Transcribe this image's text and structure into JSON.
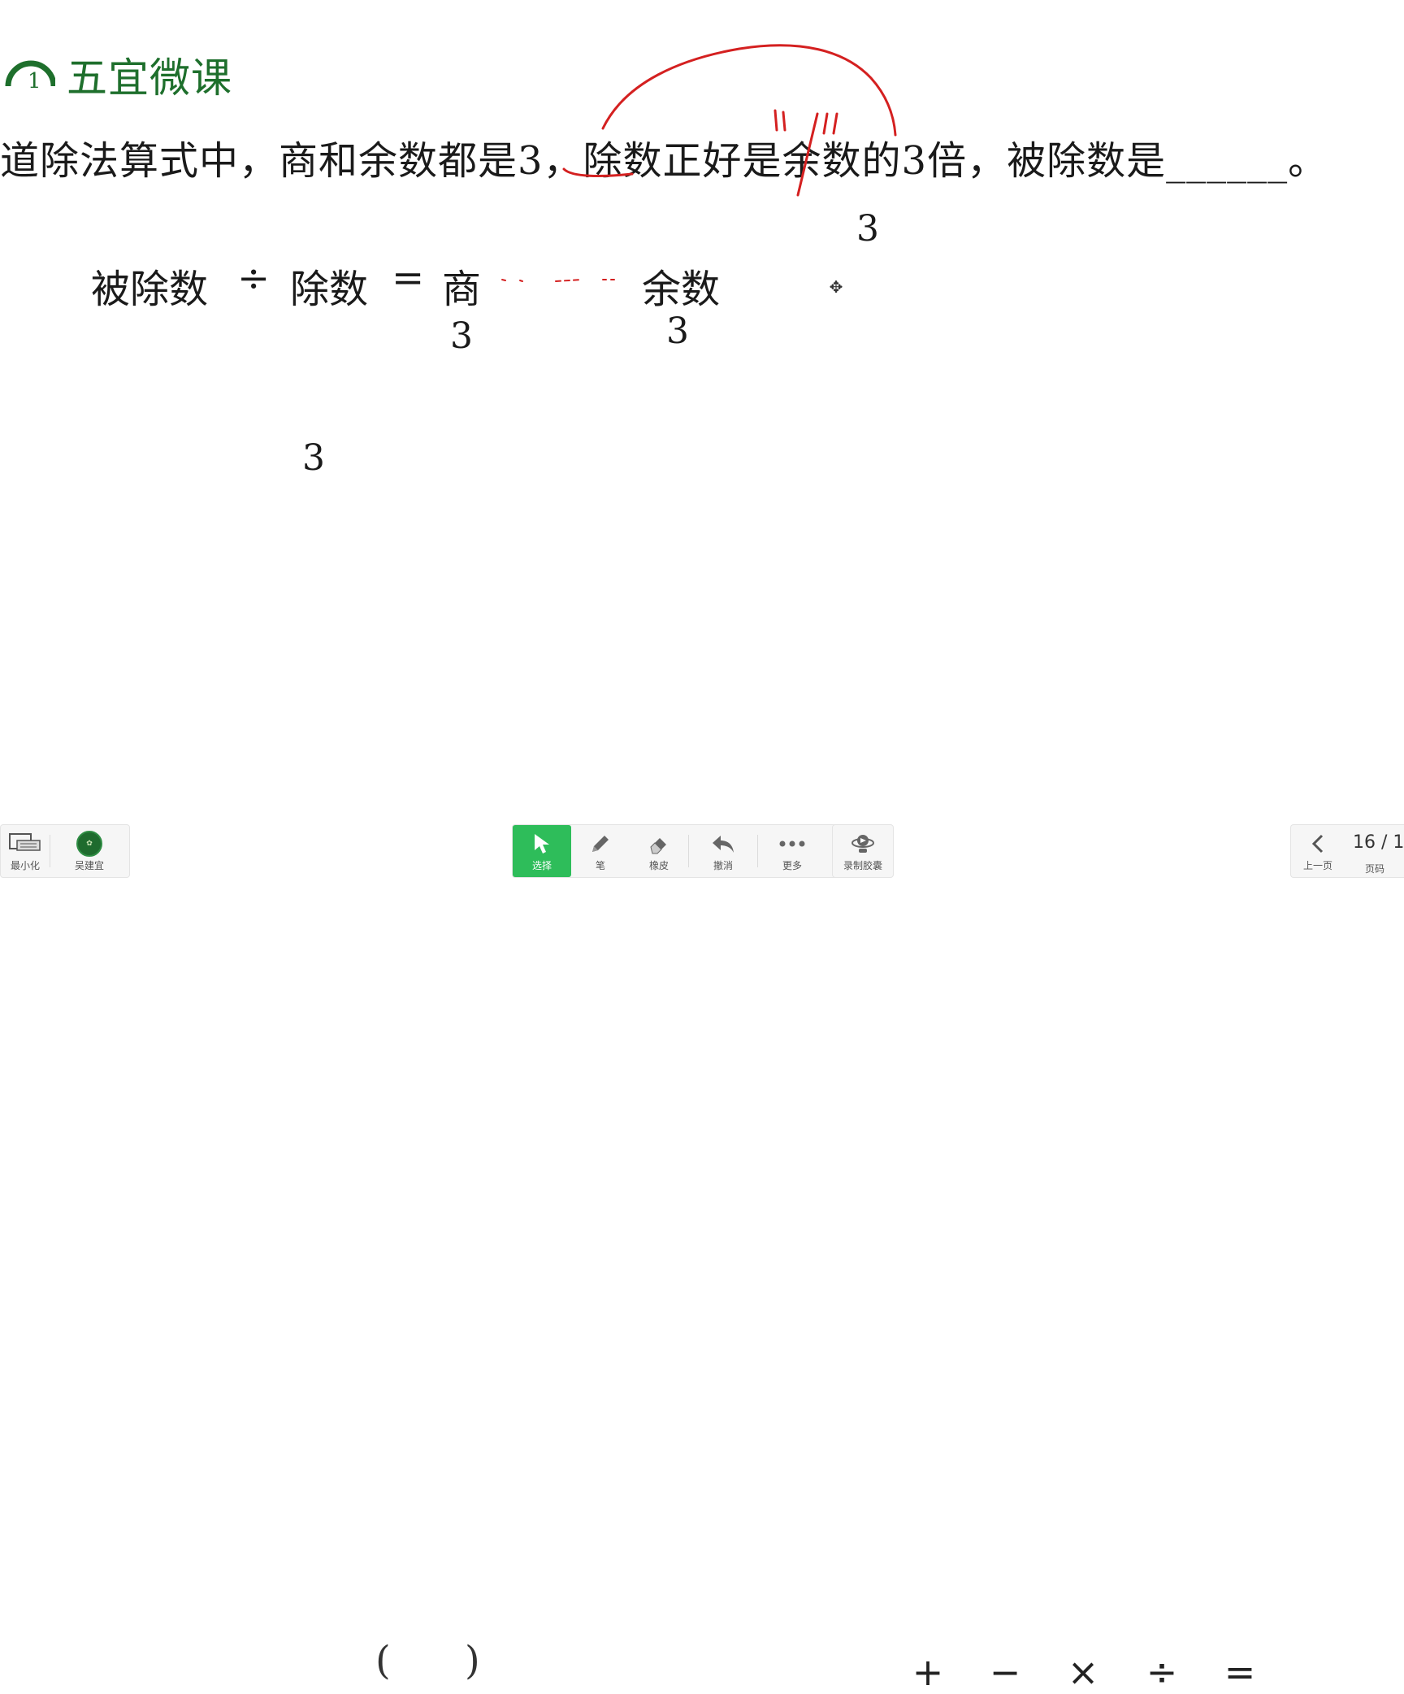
{
  "logo": {
    "circle_number": "1",
    "text": "五宜微课"
  },
  "question": {
    "text": "道除法算式中，商和余数都是3，除数正好是余数的3倍，被除数是______。"
  },
  "equation": {
    "dividend": "被除数",
    "divide_sign": "÷",
    "divisor": "除数",
    "equals_sign": "=",
    "quotient": "商",
    "remainder": "余数"
  },
  "annotations": {
    "quotient_value": "3",
    "remainder_value": "3",
    "divisor_value": "3",
    "upper_value": "3"
  },
  "toolbar": {
    "minimize_label": "最小化",
    "user_name": "吴建宜",
    "paren_left": "(",
    "paren_right": ")",
    "tools": [
      {
        "label": "选择",
        "icon": "cursor-arrow-icon",
        "active": true
      },
      {
        "label": "笔",
        "icon": "pen-icon"
      },
      {
        "label": "橡皮",
        "icon": "eraser-icon"
      },
      {
        "label": "撤消",
        "icon": "undo-icon"
      },
      {
        "label": "更多",
        "icon": "more-dots-icon"
      }
    ],
    "record_label": "录制胶囊",
    "symbols": [
      "+",
      "−",
      "×",
      "÷",
      "="
    ],
    "prev_page_label": "上一页",
    "page_label": "页码",
    "page_indicator": "16 / 1"
  },
  "colors": {
    "brand_green": "#1e6f2c",
    "active_green": "#2ebd5a",
    "ink_red": "#d42020"
  }
}
